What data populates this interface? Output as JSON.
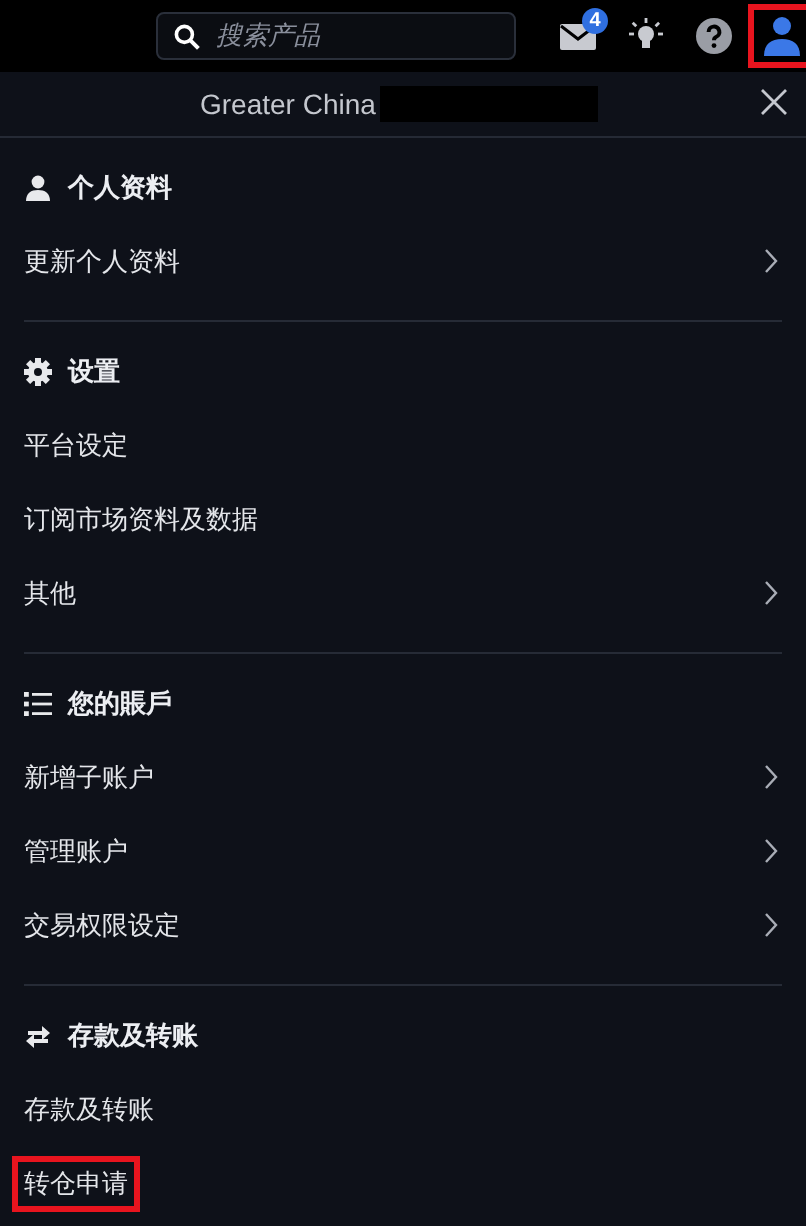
{
  "top_bar": {
    "search": {
      "placeholder": "搜索产品"
    },
    "mail_badge": "4",
    "avatar_highlighted": true
  },
  "panel": {
    "title": "Greater China",
    "redacted": true
  },
  "sections": [
    {
      "kind": "person",
      "title": "个人资料",
      "items": [
        {
          "label": "更新个人资料",
          "has_submenu": true,
          "highlighted": false
        }
      ]
    },
    {
      "kind": "gear",
      "title": "设置",
      "items": [
        {
          "label": "平台设定",
          "has_submenu": false,
          "highlighted": false
        },
        {
          "label": "订阅市场资料及数据",
          "has_submenu": false,
          "highlighted": false
        },
        {
          "label": "其他",
          "has_submenu": true,
          "highlighted": false
        }
      ]
    },
    {
      "kind": "list",
      "title": "您的賬戶",
      "items": [
        {
          "label": "新增子账户",
          "has_submenu": true,
          "highlighted": false
        },
        {
          "label": "管理账户",
          "has_submenu": true,
          "highlighted": false
        },
        {
          "label": "交易权限设定",
          "has_submenu": true,
          "highlighted": false
        }
      ]
    },
    {
      "kind": "transfer",
      "title": "存款及转账",
      "items": [
        {
          "label": "存款及转账",
          "has_submenu": false,
          "highlighted": false
        },
        {
          "label": "转仓申请",
          "has_submenu": false,
          "highlighted": true
        }
      ]
    }
  ]
}
